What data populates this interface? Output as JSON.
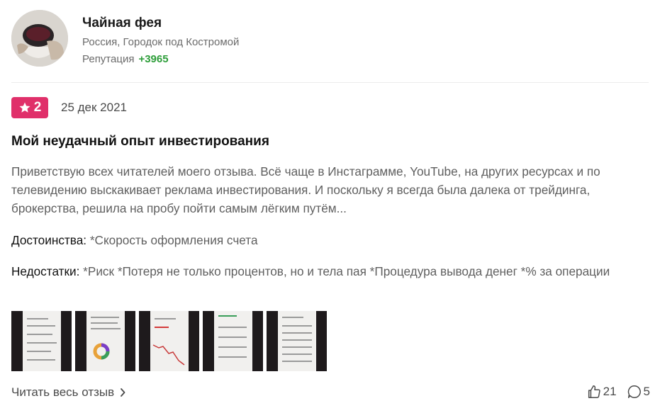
{
  "author": {
    "name": "Чайная фея",
    "location": "Россия, Городок под Костромой",
    "reputation_label": "Репутация",
    "reputation_value": "+3965"
  },
  "review": {
    "rating": "2",
    "date": "25 дек 2021",
    "title": "Мой неудачный опыт инвестирования",
    "excerpt": "Приветствую всех читателей моего отзыва. Всё чаще в Инстаграмме, YouTube, на других ресурсах и по телевидению выскакивает реклама инвестирования. И поскольку я всегда была далека от трейдинга, брокерства, решила на пробу пойти самым лёгким путём...",
    "pros_label": "Достоинства:",
    "pros_text": " *Скорость оформления счета",
    "cons_label": "Недостатки:",
    "cons_text": " *Риск *Потеря не только процентов, но и тела пая *Процедура вывода денег *% за операции",
    "read_more": "Читать весь отзыв",
    "likes": "21",
    "comments": "5"
  },
  "icons": {
    "rating": "star-icon",
    "read_more": "chevron-right-icon",
    "likes": "thumbs-up-icon",
    "comments": "comment-icon"
  },
  "colors": {
    "rating_badge": "#e0306a",
    "reputation": "#2e9e3a"
  }
}
